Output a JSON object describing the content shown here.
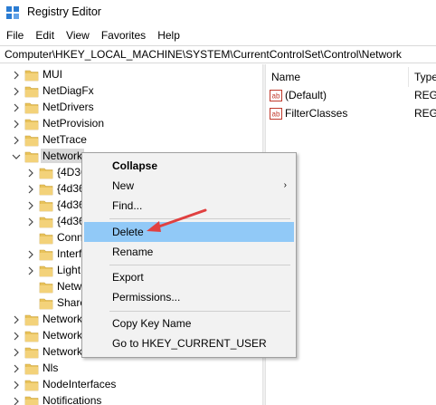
{
  "window": {
    "title": "Registry Editor"
  },
  "menubar": {
    "items": [
      "File",
      "Edit",
      "View",
      "Favorites",
      "Help"
    ]
  },
  "address": {
    "path": "Computer\\HKEY_LOCAL_MACHINE\\SYSTEM\\CurrentControlSet\\Control\\Network"
  },
  "tree": {
    "items": [
      {
        "label": "MUI",
        "expanded": false
      },
      {
        "label": "NetDiagFx",
        "expanded": false
      },
      {
        "label": "NetDrivers",
        "expanded": false
      },
      {
        "label": "NetProvision",
        "expanded": false
      },
      {
        "label": "NetTrace",
        "expanded": false
      },
      {
        "label": "Network",
        "expanded": true,
        "selected": true
      },
      {
        "label": "{4D36",
        "expanded": false
      },
      {
        "label": "{4d36",
        "expanded": false
      },
      {
        "label": "{4d36",
        "expanded": false
      },
      {
        "label": "{4d36",
        "expanded": false
      },
      {
        "label": "Conn",
        "expanded": false
      },
      {
        "label": "Interf",
        "expanded": false
      },
      {
        "label": "Light",
        "expanded": false
      },
      {
        "label": "Netw",
        "expanded": false
      },
      {
        "label": "Share",
        "expanded": false
      },
      {
        "label": "Network",
        "expanded": false
      },
      {
        "label": "Network",
        "expanded": false
      },
      {
        "label": "Network",
        "expanded": false
      },
      {
        "label": "Nls",
        "expanded": false
      },
      {
        "label": "NodeInterfaces",
        "expanded": false
      },
      {
        "label": "Notifications",
        "expanded": false
      }
    ]
  },
  "list": {
    "columns": [
      "Name",
      "Type"
    ],
    "rows": [
      {
        "name": "(Default)",
        "type": "REG_"
      },
      {
        "name": "FilterClasses",
        "type": "REG_"
      }
    ]
  },
  "context_menu": {
    "items": [
      {
        "label": "Collapse",
        "bold": true
      },
      {
        "label": "New",
        "submenu": true
      },
      {
        "label": "Find..."
      },
      {
        "label": "Delete",
        "highlighted": true
      },
      {
        "label": "Rename"
      },
      {
        "label": "Export"
      },
      {
        "label": "Permissions..."
      },
      {
        "label": "Copy Key Name"
      },
      {
        "label": "Go to HKEY_CURRENT_USER"
      }
    ],
    "submenu_glyph": "›"
  },
  "colors": {
    "highlight": "#91c9f7",
    "folder": "#e8c25a",
    "annotation_arrow": "#e04040"
  }
}
